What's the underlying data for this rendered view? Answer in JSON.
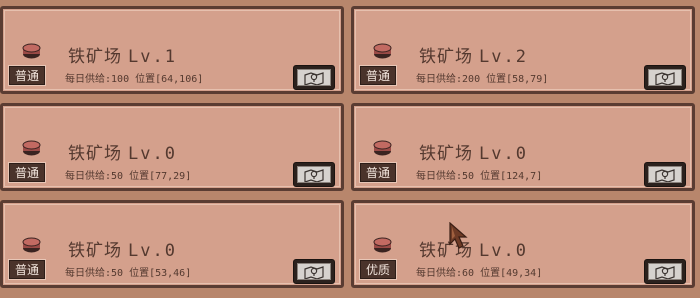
{
  "colors": {
    "background": "#b8866c",
    "card": "#d4a08c",
    "card_border": "#5a3c32",
    "text": "#54392f",
    "badge_bg": "#4a332b",
    "badge_text": "#f1e4dc",
    "ore_icon": "#b8625c"
  },
  "mines": [
    {
      "name": "铁矿场",
      "level": "Lv.1",
      "quality": "普通",
      "supply_label": "每日供给:",
      "supply": "100",
      "position_label": "位置",
      "position": "[64,106]"
    },
    {
      "name": "铁矿场",
      "level": "Lv.2",
      "quality": "普通",
      "supply_label": "每日供给:",
      "supply": "200",
      "position_label": "位置",
      "position": "[58,79]"
    },
    {
      "name": "铁矿场",
      "level": "Lv.0",
      "quality": "普通",
      "supply_label": "每日供给:",
      "supply": "50",
      "position_label": "位置",
      "position": "[77,29]"
    },
    {
      "name": "铁矿场",
      "level": "Lv.0",
      "quality": "普通",
      "supply_label": "每日供给:",
      "supply": "50",
      "position_label": "位置",
      "position": "[124,7]"
    },
    {
      "name": "铁矿场",
      "level": "Lv.0",
      "quality": "普通",
      "supply_label": "每日供给:",
      "supply": "50",
      "position_label": "位置",
      "position": "[53,46]"
    },
    {
      "name": "铁矿场",
      "level": "Lv.0",
      "quality": "优质",
      "supply_label": "每日供给:",
      "supply": "60",
      "position_label": "位置",
      "position": "[49,34]"
    }
  ],
  "icons": {
    "resource": "iron-ore-icon",
    "map_button": "map-pin-icon",
    "cursor": "arrow-cursor-icon"
  }
}
